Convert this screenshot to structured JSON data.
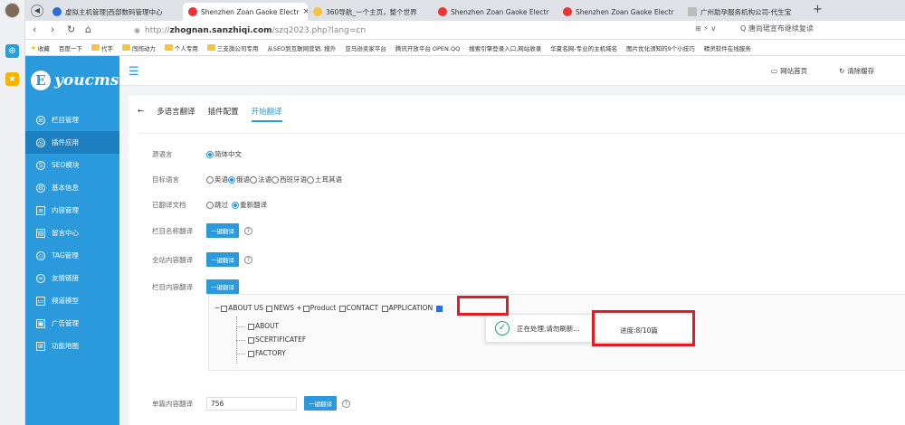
{
  "browser": {
    "tabs": [
      {
        "label": "虚拟主机管理|西部数码管理中心"
      },
      {
        "label": "Shenzhen Zoan Gaoke Electr"
      },
      {
        "label": "360导航_一个主页，整个世界"
      },
      {
        "label": "Shenzhen Zoan Gaoke Electr"
      },
      {
        "label": "Shenzhen Zoan Gaoke Electr"
      },
      {
        "label": "广州助孕服务机构公司-代生宝"
      }
    ],
    "url_prefix": "http://",
    "url_host": "zhognan.sanzhiqi.com",
    "url_path": "/szq2023.php?lang=cn",
    "search_text": "Q 唐尚珺宣布继续复读",
    "bookmarks": [
      "收藏",
      "百度一下",
      "代字",
      "闯闯动力",
      "个人专用",
      "三支旗公司专用",
      "从SEO到互联网营销, 搜外",
      "亚马逊卖家平台",
      "腾讯开放平台 OPEN.QQ",
      "搜索引擎登录入口,网站收录",
      "华夏名网-专业的主机域名",
      "图片优化须知的9个小技巧",
      "精灵软件在线服务"
    ]
  },
  "sidebar": {
    "logo": "youcms",
    "logo_letter": "E",
    "items": [
      {
        "label": "栏目管理",
        "icon": "layers-icon"
      },
      {
        "label": "插件应用",
        "icon": "plugin-icon"
      },
      {
        "label": "SEO模块",
        "icon": "seo-icon"
      },
      {
        "label": "基本信息",
        "icon": "settings-icon"
      },
      {
        "label": "内容管理",
        "icon": "content-icon"
      },
      {
        "label": "留言中心",
        "icon": "message-icon"
      },
      {
        "label": "TAG管理",
        "icon": "tag-icon"
      },
      {
        "label": "友情链接",
        "icon": "link-icon"
      },
      {
        "label": "频道模型",
        "icon": "channel-icon"
      },
      {
        "label": "广告管理",
        "icon": "ad-icon"
      },
      {
        "label": "功能地图",
        "icon": "map-icon"
      }
    ]
  },
  "header": {
    "home_label": "网站首页",
    "clear_cache_label": "清除缓存"
  },
  "panel": {
    "back": "←",
    "title": "多语言翻译",
    "tab_config": "插件配置",
    "tab_translate": "开始翻译",
    "source_label": "源语言",
    "source_value": "简体中文",
    "target_label": "目标语言",
    "target_options": [
      "英语",
      "俄语",
      "法语",
      "西班牙语",
      "土耳其语"
    ],
    "translated_label": "已翻译文档",
    "translated_options": [
      "跳过",
      "重新翻译"
    ],
    "column_name_label": "栏目名称翻译",
    "whole_site_label": "全站内容翻译",
    "column_content_label": "栏目内容翻译",
    "one_click": "一键翻译",
    "single_label": "单篇内容翻译",
    "single_value": "756"
  },
  "tree": {
    "top_items": [
      "ABOUT US",
      "NEWS",
      "Product",
      "CONTACT",
      "APPLICATION"
    ],
    "children": [
      "ABOUT",
      "SCERTIFICATEF",
      "FACTORY"
    ]
  },
  "toast": {
    "message": "正在处理,请勿刷新...",
    "progress": "进度:8/10篇"
  }
}
